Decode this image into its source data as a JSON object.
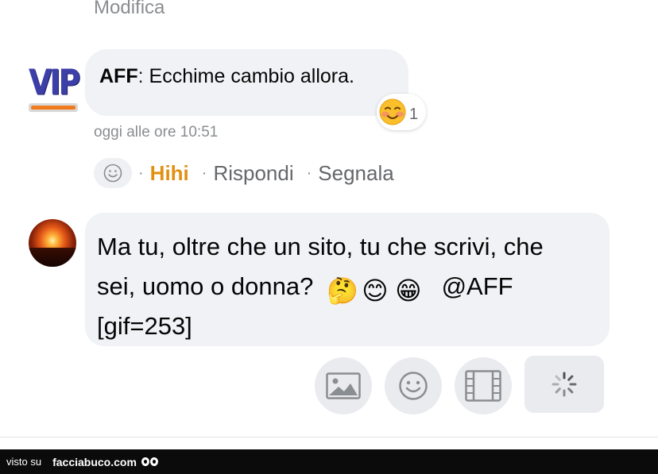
{
  "previous_comment": {
    "edit_label": "Modifica"
  },
  "comment1": {
    "badge": "VIP",
    "author": "AFF",
    "separator": ": ",
    "text": "Ecchime cambio allora.",
    "timestamp": "oggi alle ore 10:51",
    "reaction": {
      "emoji": "☺",
      "emoji_name": "smiling-face-icon",
      "count": "1"
    },
    "actions": {
      "react_icon": "smiley-icon",
      "dot": "·",
      "hihi": "Hihi",
      "reply": "Rispondi",
      "report": "Segnala"
    }
  },
  "reply_box": {
    "avatar": "sunset-avatar",
    "text_line1": "Ma tu, oltre che un sito, tu che scrivi, che",
    "text_line2": "sei, uomo o donna?",
    "emojis": [
      "🤔",
      "😊",
      "😁"
    ],
    "mention": "@AFF",
    "text_line3": "[gif=253]",
    "toolbar": [
      "image-icon",
      "emoji-icon",
      "film-icon",
      "loading-spinner-icon"
    ]
  },
  "footer": {
    "visto_su": "visto su",
    "brand": "facciabuco.com"
  },
  "colors": {
    "accent": "#e29012",
    "bubble": "#f0f2f5",
    "muted": "#8a8d91"
  }
}
